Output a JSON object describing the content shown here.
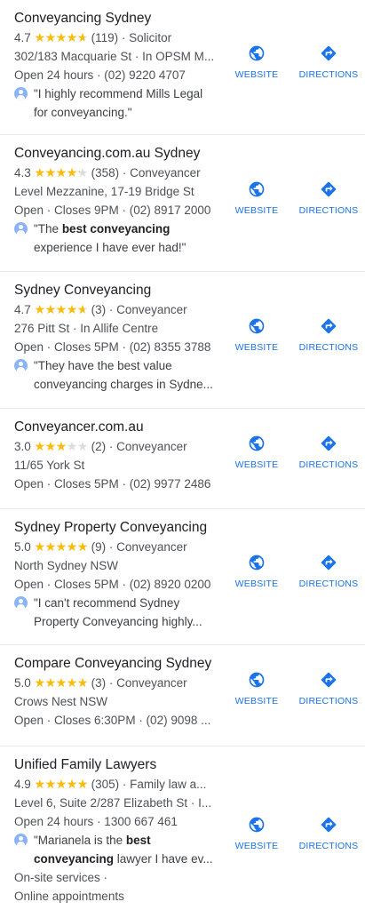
{
  "colors": {
    "link_blue": "#1a73e8",
    "star": "#fbbc04",
    "star_empty": "#dadce0",
    "divider": "#e8eaed"
  },
  "icons": {
    "website": "globe-icon",
    "directions": "directions-diamond-icon",
    "reviewer": "person-avatar-icon"
  },
  "actions": {
    "website_label": "WEBSITE",
    "directions_label": "DIRECTIONS"
  },
  "listings": [
    {
      "name": "Conveyancing Sydney",
      "rating": "4.7",
      "stars": 4.7,
      "reviews": "(119)",
      "category": "Solicitor",
      "address": "302/183 Macquarie St · In OPSM M...",
      "hours": "Open 24 hours · (02) 9220 4707",
      "review_parts": [
        [
          "\"I highly recommend Mills Legal",
          ""
        ],
        [
          "for conveyancing.\"",
          ""
        ]
      ]
    },
    {
      "name": "Conveyancing.com.au Sydney",
      "rating": "4.3",
      "stars": 4.3,
      "reviews": "(358)",
      "category": "Conveyancer",
      "address": "Level Mezzanine, 17-19 Bridge St",
      "hours": "Open · Closes 9PM · (02) 8917 2000",
      "review_l1_a": "\"The ",
      "review_l1_b": "best conveyancing",
      "review_l2": "experience I have ever had!\""
    },
    {
      "name": "Sydney Conveyancing",
      "rating": "4.7",
      "stars": 4.7,
      "reviews": "(3)",
      "category": "Conveyancer",
      "address": "276 Pitt St · In Allife Centre",
      "hours": "Open · Closes 5PM · (02) 8355 3788",
      "review_l1": "\"They have the best value",
      "review_l2": "conveyancing charges in Sydne..."
    },
    {
      "name": "Conveyancer.com.au",
      "rating": "3.0",
      "stars": 3.0,
      "reviews": "(2)",
      "category": "Conveyancer",
      "address": "11/65 York St",
      "hours": "Open · Closes 5PM · (02) 9977 2486"
    },
    {
      "name": "Sydney Property Conveyancing",
      "rating": "5.0",
      "stars": 5.0,
      "reviews": "(9)",
      "category": "Conveyancer",
      "address": "North Sydney NSW",
      "hours": "Open · Closes 5PM · (02) 8920 0200",
      "review_l1": "\"I can't recommend Sydney",
      "review_l2": "Property Conveyancing highly..."
    },
    {
      "name": "Compare Conveyancing Sydney",
      "rating": "5.0",
      "stars": 5.0,
      "reviews": "(3)",
      "category": "Conveyancer",
      "address": "Crows Nest NSW",
      "hours": "Open · Closes 6:30PM · (02) 9098 ..."
    },
    {
      "name": "Unified Family Lawyers",
      "rating": "4.9",
      "stars": 4.9,
      "reviews": "(305)",
      "category": "Family law a...",
      "address": "Level 6, Suite 2/287 Elizabeth St · I...",
      "hours": "Open 24 hours · 1300 667 461",
      "review_l1_a": "\"Marianela is the ",
      "review_l1_b": "best",
      "review_l2_b": "conveyancing",
      "review_l2_a": " lawyer I have ev...",
      "extra_1": "On-site services ·",
      "extra_2": "Online appointments"
    }
  ]
}
